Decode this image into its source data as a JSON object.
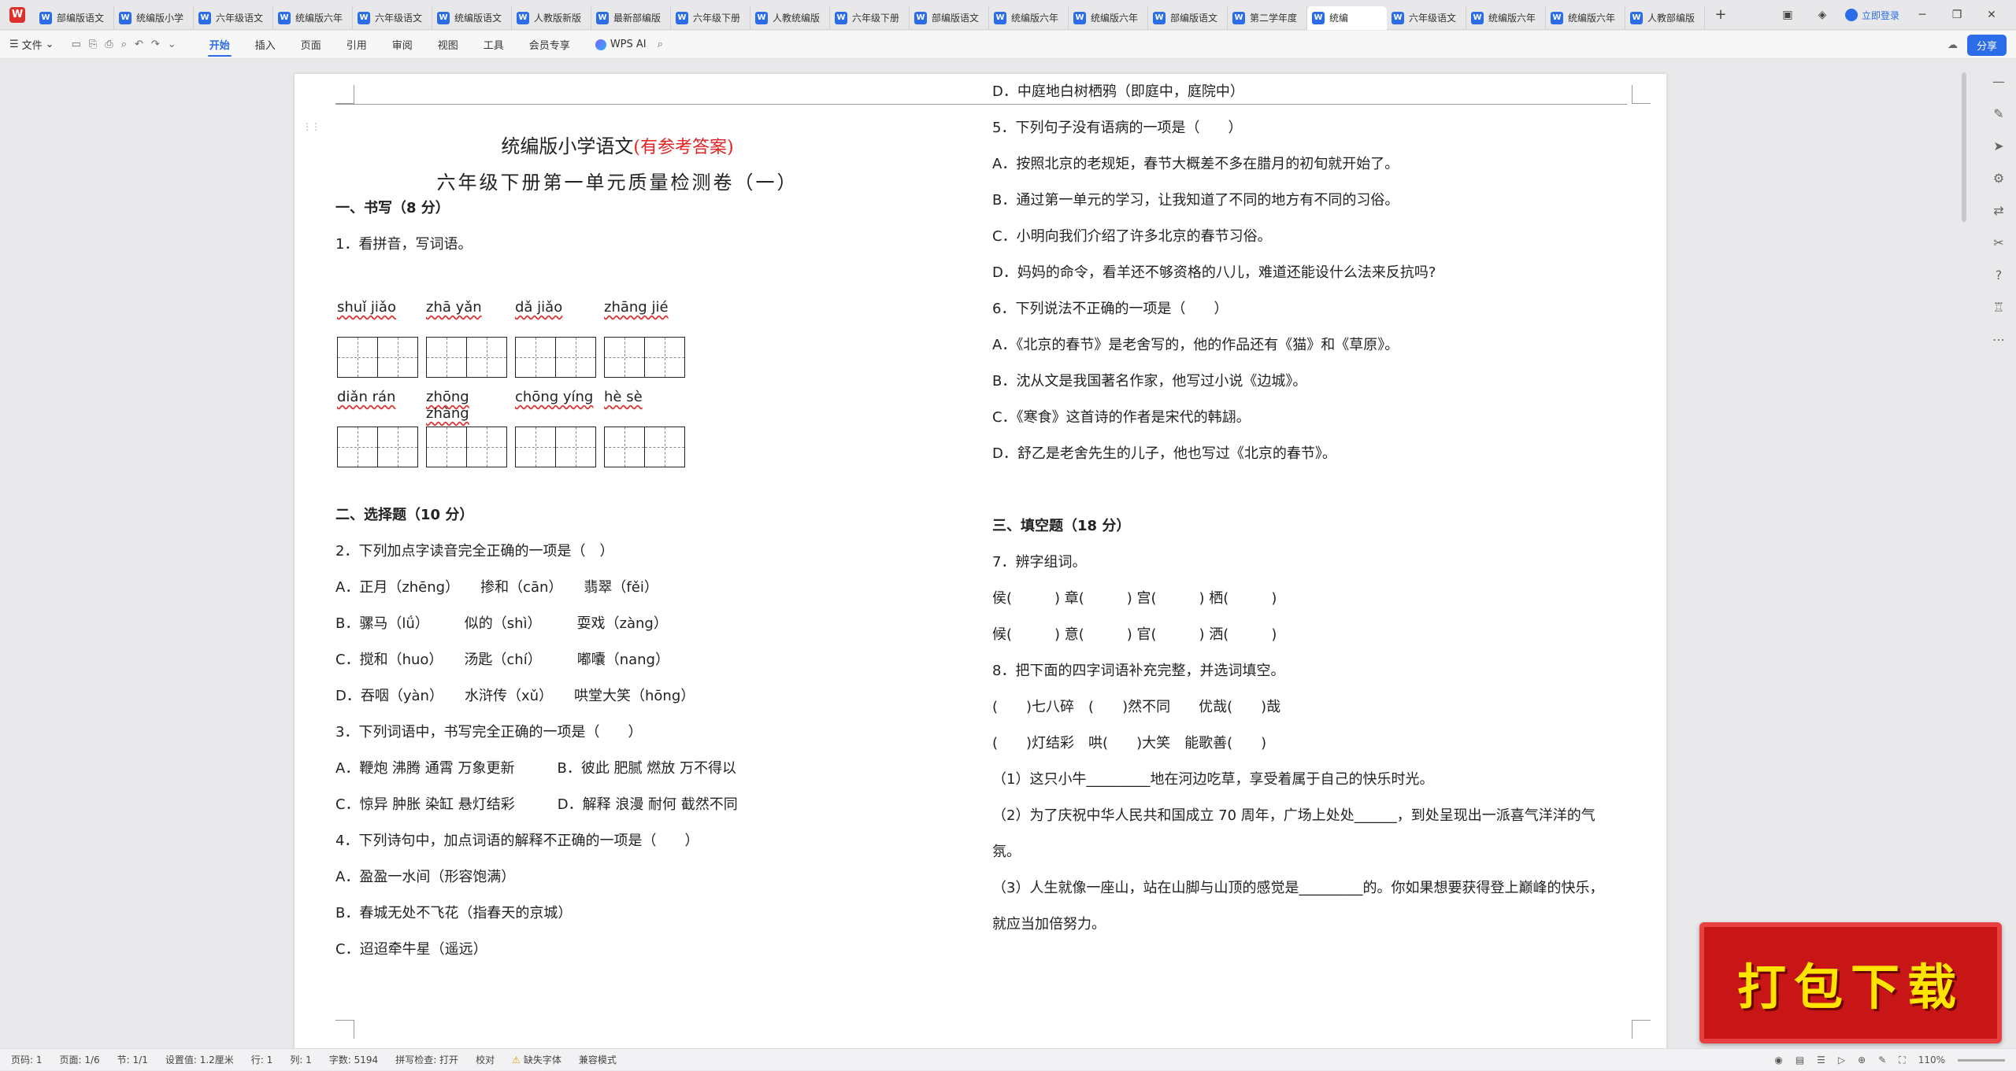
{
  "tabs": [
    {
      "label": "部编版语文"
    },
    {
      "label": "统编版小学"
    },
    {
      "label": "六年级语文"
    },
    {
      "label": "统编版六年"
    },
    {
      "label": "六年级语文"
    },
    {
      "label": "统编版语文"
    },
    {
      "label": "人教版新版"
    },
    {
      "label": "最新部编版"
    },
    {
      "label": "六年级下册"
    },
    {
      "label": "人教统编版"
    },
    {
      "label": "六年级下册"
    },
    {
      "label": "部编版语文"
    },
    {
      "label": "统编版六年"
    },
    {
      "label": "统编版六年"
    },
    {
      "label": "部编版语文"
    },
    {
      "label": "第二学年度"
    },
    {
      "label": "统编"
    },
    {
      "label": "六年级语文"
    },
    {
      "label": "统编版六年"
    },
    {
      "label": "统编版六年"
    },
    {
      "label": "人教部编版"
    }
  ],
  "tabbar": {
    "add": "+",
    "login": "立即登录"
  },
  "menubar": {
    "file": "文件",
    "items": [
      "开始",
      "插入",
      "页面",
      "引用",
      "审阅",
      "视图",
      "工具",
      "会员专享"
    ],
    "ai": "WPS AI",
    "share": "分享"
  },
  "doc": {
    "title": "统编版小学语文",
    "title_tag": "(有参考答案)",
    "subtitle": "六年级下册第一单元质量检测卷（一）",
    "left": [
      {
        "t": "一、书写（8 分）",
        "sec": true
      },
      {
        "t": "1．看拼音，写词语。"
      }
    ],
    "pinyin1": [
      "shuǐ jiǎo",
      "zhā yǎn",
      "dǎ jiǎo",
      "zhāng jié"
    ],
    "pinyin2": [
      "diǎn rán",
      "zhōng zhàng",
      "chōng yíng",
      "hè sè"
    ],
    "left2": [
      {
        "t": "二、选择题（10 分）",
        "sec": true
      },
      {
        "t": "2．下列加点字读音完全正确的一项是（　）"
      },
      {
        "t": "A．正月（zhēng）　　掺和（cān）　　翡翠（fěi）"
      },
      {
        "t": "B．骡马（lǘ）　　　似的（shì）　　　耍戏（zàng）"
      },
      {
        "t": "C．搅和（huo）　　汤匙（chí）　　　嘟囔（nang）"
      },
      {
        "t": "D．吞咽（yàn）　　水浒传（xǔ）　　哄堂大笑（hōng）"
      },
      {
        "t": "3．下列词语中，书写完全正确的一项是（　　）"
      },
      {
        "t": "A．鞭炮  沸腾  通霄  万象更新　　　B．彼此  肥腻  燃放  万不得以"
      },
      {
        "t": "C．惊异  肿胀  染缸  悬灯结彩　　　D．解释  浪漫  耐何  截然不同"
      },
      {
        "t": "4．下列诗句中，加点词语的解释不正确的一项是（　　）"
      },
      {
        "t": "A．盈盈一水间（形容饱满）"
      },
      {
        "t": "B．春城无处不飞花（指春天的京城）"
      },
      {
        "t": "C．迢迢牵牛星（遥远）"
      }
    ],
    "right": [
      {
        "t": "D．中庭地白树栖鸦（即庭中，庭院中）"
      },
      {
        "t": "5．下列句子没有语病的一项是（　　）"
      },
      {
        "t": "A．按照北京的老规矩，春节大概差不多在腊月的初旬就开始了。"
      },
      {
        "t": "B．通过第一单元的学习，让我知道了不同的地方有不同的习俗。"
      },
      {
        "t": "C．小明向我们介绍了许多北京的春节习俗。"
      },
      {
        "t": "D．妈妈的命令，看羊还不够资格的八儿，难道还能设什么法来反抗吗?"
      },
      {
        "t": "6．下列说法不正确的一项是（　　）"
      },
      {
        "t": "A．《北京的春节》是老舍写的，他的作品还有《猫》和《草原》。"
      },
      {
        "t": "B．沈从文是我国著名作家，他写过小说《边城》。"
      },
      {
        "t": "C．《寒食》这首诗的作者是宋代的韩翃。"
      },
      {
        "t": "D．舒乙是老舍先生的儿子，他也写过《北京的春节》。"
      },
      {
        "t": ""
      },
      {
        "t": "三、填空题（18 分）",
        "sec": true
      },
      {
        "t": "7．辨字组词。"
      },
      {
        "t": "侯(　　　)  章(　　　)  宫(　　　)  栖(　　　)"
      },
      {
        "t": "候(　　　)  意(　　　)  官(　　　)  洒(　　　)"
      },
      {
        "t": "8．把下面的四字词语补充完整，并选词填空。"
      },
      {
        "t": "(　　)七八碎　(　　)然不同　　优哉(　　)哉"
      },
      {
        "t": "(　　)灯结彩　哄(　　)大笑　能歌善(　　)"
      },
      {
        "t": "（1）这只小牛_________地在河边吃草，享受着属于自己的快乐时光。"
      },
      {
        "t": "（2）为了庆祝中华人民共和国成立 70 周年，广场上处处______，到处呈现出一派喜气洋洋的气"
      },
      {
        "t": "氛。"
      },
      {
        "t": "（3）人生就像一座山，站在山脚与山顶的感觉是_________的。你如果想要获得登上巅峰的快乐，"
      },
      {
        "t": "就应当加倍努力。"
      }
    ]
  },
  "status": {
    "page": "页码: 1",
    "pages": "页面: 1/6",
    "section": "节: 1/1",
    "setting": "设置值: 1.2厘米",
    "row": "行: 1",
    "col": "列: 1",
    "words": "字数: 5194",
    "spell": "拼写检查: 打开",
    "proof": "校对",
    "font_missing": "缺失字体",
    "compat": "兼容模式",
    "zoom": "110%"
  },
  "promo": {
    "text": "打包下载"
  },
  "colors": {
    "accent": "#2b6de8",
    "promo_bg": "#c81616",
    "promo_text": "#ffe400",
    "title_red": "#e02222"
  }
}
